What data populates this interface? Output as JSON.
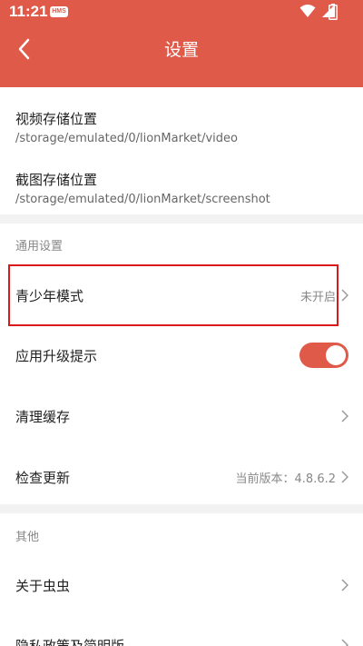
{
  "status_bar": {
    "time": "11:21",
    "hms_badge": "HMS"
  },
  "header": {
    "title": "设置"
  },
  "paths": [
    {
      "title": "视频存储位置",
      "value": "/storage/emulated/0/lionMarket/video"
    },
    {
      "title": "截图存储位置",
      "value": "/storage/emulated/0/lionMarket/screenshot"
    }
  ],
  "general": {
    "section_title": "通用设置",
    "teen_mode": {
      "label": "青少年模式",
      "value": "未开启"
    },
    "upgrade_prompt": {
      "label": "应用升级提示",
      "enabled": true
    },
    "clear_cache": {
      "label": "清理缓存"
    },
    "check_update": {
      "label": "检查更新",
      "value": "当前版本：4.8.6.2"
    }
  },
  "other": {
    "section_title": "其他",
    "about": {
      "label": "关于虫虫"
    },
    "privacy": {
      "label": "隐私政策及简明版"
    }
  },
  "colors": {
    "accent": "#e05a4a",
    "highlight": "#d81a1a"
  }
}
